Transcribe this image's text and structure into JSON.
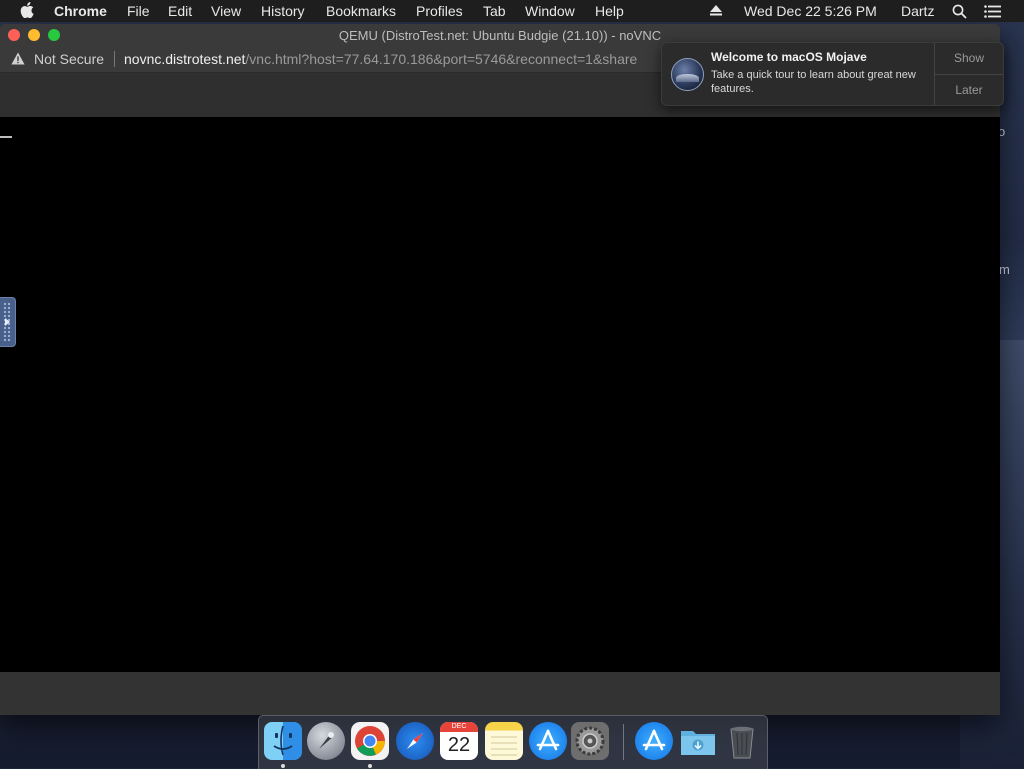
{
  "menubar": {
    "app_name": "Chrome",
    "menus": [
      "File",
      "Edit",
      "View",
      "History",
      "Bookmarks",
      "Profiles",
      "Tab",
      "Window",
      "Help"
    ],
    "clock": "Wed Dec 22  5:26 PM",
    "user": "Dartz"
  },
  "window": {
    "title": "QEMU (DistroTest.net: Ubuntu Budgie (21.10)) - noVNC",
    "security_label": "Not Secure",
    "url_host": "novnc.distrotest.net",
    "url_rest": "/vnc.html?host=77.64.170.186&port=5746&reconnect=1&share"
  },
  "notification": {
    "title": "Welcome to macOS Mojave",
    "body": "Take a quick tour to learn about great new features.",
    "show_label": "Show",
    "later_label": "Later"
  },
  "desktop": {
    "edge_text_1": "o",
    "edge_text_2": "m"
  },
  "dock": {
    "apps": [
      "finder-icon",
      "launchpad-icon",
      "chrome-icon",
      "safari-icon",
      "calendar-icon",
      "notes-icon",
      "app-store-icon",
      "system-preferences-icon",
      "app-store-icon",
      "downloads-folder-icon",
      "trash-icon"
    ],
    "calendar_month": "DEC",
    "calendar_day": "22"
  },
  "colors": {
    "close": "#fe5f57",
    "minimize": "#febc2e",
    "zoom": "#28c840"
  }
}
